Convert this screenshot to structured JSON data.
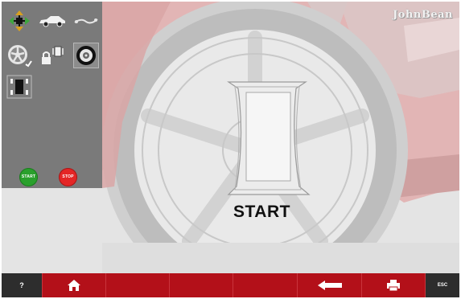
{
  "brand": {
    "name": "JohnBean"
  },
  "sidebar": {
    "start_label": "START",
    "stop_label": "STOP",
    "icons": [
      "alignment-cross-icon",
      "car-side-icon",
      "steering-axle-icon",
      "wheel-rim-icon",
      "lock-target-icon",
      "tire-target-icon",
      "car-top-view-icon"
    ],
    "selected_icon": "tire-target-icon"
  },
  "main": {
    "instruction": "START"
  },
  "bottombar": {
    "help_label": "?",
    "esc_label": "ESC",
    "buttons": [
      "help-button",
      "home-button",
      "empty",
      "empty",
      "empty",
      "back-button",
      "print-button",
      "esc-button"
    ]
  },
  "colors": {
    "bar_red": "#b31019",
    "start_green": "#2aa02c",
    "stop_red": "#e42626",
    "sidebar_gray": "#7a7a7a"
  }
}
